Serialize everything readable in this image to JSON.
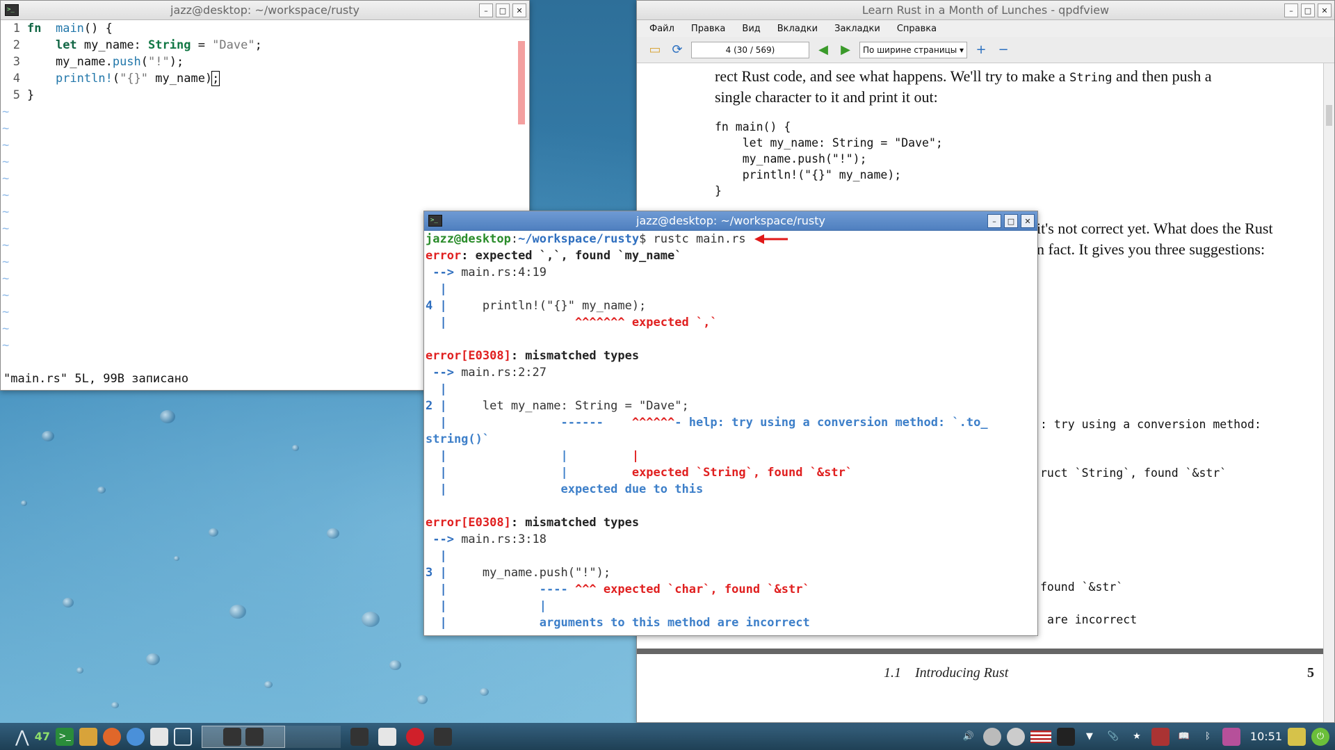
{
  "vim": {
    "title": "jazz@desktop: ~/workspace/rusty",
    "lines": [
      {
        "n": "1",
        "parts": [
          [
            "kw",
            "fn"
          ],
          [
            "",
            "  "
          ],
          [
            "fnname",
            "main"
          ],
          [
            "",
            "() {"
          ]
        ]
      },
      {
        "n": "2",
        "parts": [
          [
            "",
            "    "
          ],
          [
            "kw",
            "let"
          ],
          [
            "",
            " my_name: "
          ],
          [
            "ty",
            "String"
          ],
          [
            "",
            " = "
          ],
          [
            "str",
            "\"Dave\""
          ],
          [
            "",
            ";"
          ]
        ]
      },
      {
        "n": "3",
        "parts": [
          [
            "",
            "    my_name."
          ],
          [
            "mac",
            "push"
          ],
          [
            "",
            "("
          ],
          [
            "str",
            "\"!\""
          ],
          [
            "",
            ");"
          ]
        ]
      },
      {
        "n": "4",
        "parts": [
          [
            "",
            "    "
          ],
          [
            "mac",
            "println!"
          ],
          [
            "",
            "("
          ],
          [
            "str",
            "\"{}\""
          ],
          [
            "",
            " my_name)"
          ],
          [
            "cursor",
            ";"
          ]
        ]
      },
      {
        "n": "5",
        "parts": [
          [
            "",
            "}"
          ]
        ]
      }
    ],
    "status": "\"main.rs\" 5L, 99B записано"
  },
  "pdf": {
    "title": "Learn Rust in a Month of Lunches - qpdfview",
    "menu": [
      "Файл",
      "Правка",
      "Вид",
      "Вкладки",
      "Закладки",
      "Справка"
    ],
    "page_field": "4 (30 / 569)",
    "zoom": "По ширине страницы",
    "text1a": "rect Rust code, and see what happens. We'll try to make a",
    "text1b": "String",
    "text1c": "and then push a",
    "text2": "single character to it and print it out:",
    "code": [
      "fn main() {",
      "    let my_name: String = \"Dave\";",
      "    my_name.push(\"!\");",
      "    println!(\"{}\" my_name);",
      "}"
    ],
    "text3": "it's not correct yet. What does the Rust",
    "text4": "n fact. It gives you three suggestions:",
    "frag1": ": try using a conversion method:",
    "frag2": "ruct `String`, found `&str`",
    "frag3": "found `&str`",
    "frag4": "are incorrect",
    "section": "1.1    Introducing Rust",
    "page_num": "5"
  },
  "terminal": {
    "title": "jazz@desktop: ~/workspace/rusty",
    "prompt_user": "jazz@desktop",
    "prompt_path": "~/workspace/rusty",
    "prompt_cmd": "$ rustc main.rs",
    "lines": [
      [
        [
          "t-red",
          "error"
        ],
        [
          "t-bold",
          ": expected `,`, found `my_name`"
        ]
      ],
      [
        [
          "t-blue",
          " --> "
        ],
        [
          "t-grey",
          "main.rs:4:19"
        ]
      ],
      [
        [
          "t-blue",
          "  |"
        ]
      ],
      [
        [
          "t-blue",
          "4 |"
        ],
        [
          "t-grey",
          "     println!(\"{}\" my_name);"
        ]
      ],
      [
        [
          "t-blue",
          "  |"
        ],
        [
          "t-red",
          "                  ^^^^^^^ expected `,`"
        ]
      ],
      [
        [
          "",
          ""
        ]
      ],
      [
        [
          "t-red",
          "error[E0308]"
        ],
        [
          "t-bold",
          ": mismatched types"
        ]
      ],
      [
        [
          "t-blue",
          " --> "
        ],
        [
          "t-grey",
          "main.rs:2:27"
        ]
      ],
      [
        [
          "t-blue",
          "  |"
        ]
      ],
      [
        [
          "t-blue",
          "2 |"
        ],
        [
          "t-grey",
          "     let my_name: String = \"Dave\";"
        ]
      ],
      [
        [
          "t-blue",
          "  |"
        ],
        [
          "t-help",
          "                ------    "
        ],
        [
          "t-red",
          "^^^^^^"
        ],
        [
          "t-help",
          "- help: try using a conversion method: `.to_"
        ]
      ],
      [
        [
          "t-help",
          "string()`"
        ]
      ],
      [
        [
          "t-blue",
          "  |"
        ],
        [
          "t-help",
          "                |         "
        ],
        [
          "t-red",
          "|"
        ]
      ],
      [
        [
          "t-blue",
          "  |"
        ],
        [
          "t-help",
          "                |         "
        ],
        [
          "t-red",
          "expected `String`, found `&str`"
        ]
      ],
      [
        [
          "t-blue",
          "  |"
        ],
        [
          "t-help",
          "                expected due to this"
        ]
      ],
      [
        [
          "",
          ""
        ]
      ],
      [
        [
          "t-red",
          "error[E0308]"
        ],
        [
          "t-bold",
          ": mismatched types"
        ]
      ],
      [
        [
          "t-blue",
          " --> "
        ],
        [
          "t-grey",
          "main.rs:3:18"
        ]
      ],
      [
        [
          "t-blue",
          "  |"
        ]
      ],
      [
        [
          "t-blue",
          "3 |"
        ],
        [
          "t-grey",
          "     my_name.push(\"!\");"
        ]
      ],
      [
        [
          "t-blue",
          "  |"
        ],
        [
          "t-help",
          "             ---- "
        ],
        [
          "t-red",
          "^^^ expected `char`, found `&str`"
        ]
      ],
      [
        [
          "t-blue",
          "  |"
        ],
        [
          "t-help",
          "             |"
        ]
      ],
      [
        [
          "t-blue",
          "  |"
        ],
        [
          "t-help",
          "             arguments to this method are incorrect"
        ]
      ]
    ]
  },
  "taskbar": {
    "badge": "47",
    "clock": "10:51"
  }
}
